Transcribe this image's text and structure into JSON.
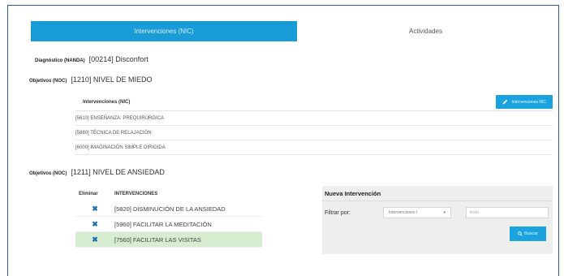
{
  "tabs": [
    {
      "label": "Intervenciones (NIC)",
      "active": true
    },
    {
      "label": "Actividades",
      "active": false
    }
  ],
  "diagnosis": {
    "label": "Diagnóstico (NANDA)",
    "value": "[00214] Disconfort"
  },
  "objective1": {
    "label": "Objetivos (NOC)",
    "value": "[1210] NIVEL DE MIEDO"
  },
  "nic_table": {
    "header": "Intervenciones (NIC)",
    "button_label": "Intervenciones NIC",
    "rows": [
      "[5610] ENSEÑANZA: PREQUIRÚRGICA",
      "[5880] TÉCNICA DE RELAJACIÓN",
      "[6000] IMAGINACIÓN SIMPLE DIRIGIDA"
    ]
  },
  "objective2": {
    "label": "Objetivos (NOC)",
    "value": "[1211] NIVEL DE ANSIEDAD"
  },
  "interventions": {
    "col_delete": "Eliminar",
    "col_name": "INTERVENCIONES",
    "rows": [
      {
        "label": "[5820] DISMINUCIÓN DE LA ANSIEDAD",
        "highlighted": false
      },
      {
        "label": "[5960] FACILITAR LA MEDITACIÓN",
        "highlighted": false
      },
      {
        "label": "[7560] FACILITAR LAS VISITAS",
        "highlighted": true
      }
    ]
  },
  "new_intervention": {
    "title": "Nueva Intervención",
    "filter_label": "Filtrar por:",
    "select_value": "Intervenciones I",
    "text_placeholder": "texto",
    "search_label": "Buscar"
  },
  "colors": {
    "accent": "#189bd6",
    "highlight": "#d6edd0",
    "delete_icon": "#1a6fb5"
  },
  "icons": {
    "edit": "pencil-icon",
    "delete": "x-icon",
    "search": "search-icon",
    "dropdown": "chevron-down-icon"
  }
}
